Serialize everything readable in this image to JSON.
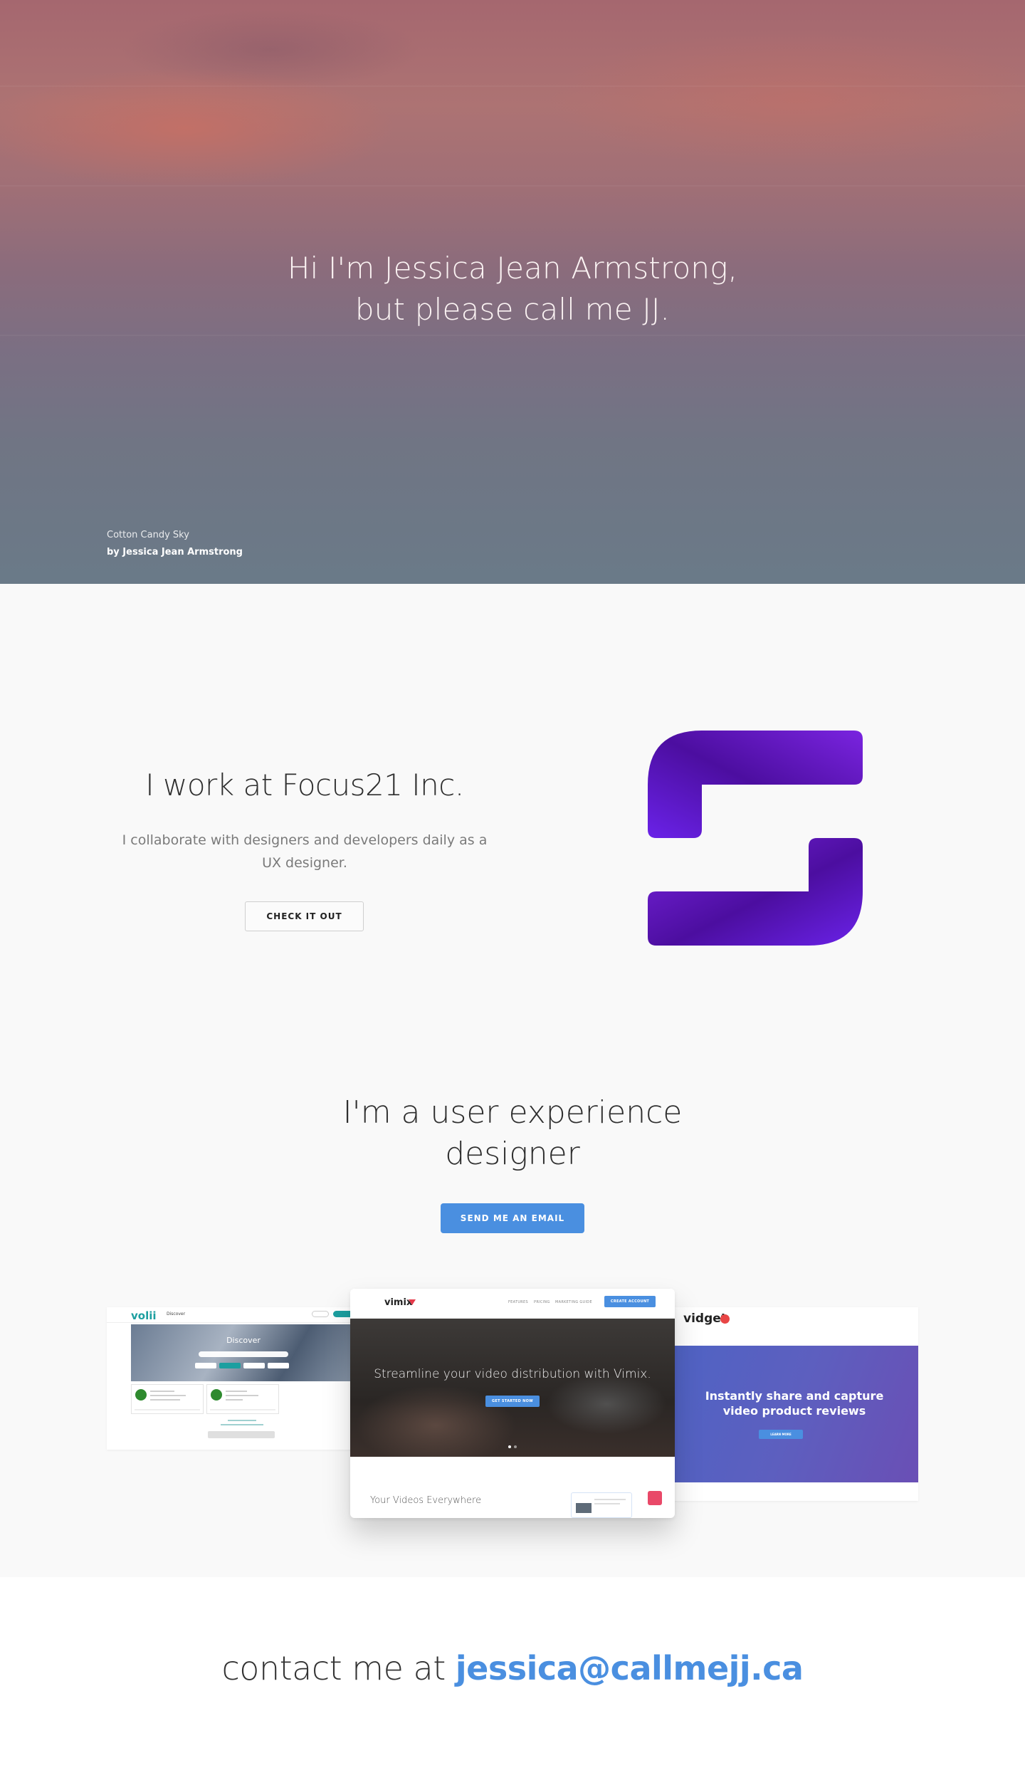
{
  "hero": {
    "title_line1": "Hi I'm Jessica Jean Armstrong,",
    "title_line2": "but please call me JJ.",
    "photo_title": "Cotton Candy Sky",
    "photo_author": "by Jessica Jean Armstrong"
  },
  "work": {
    "title": "I work at Focus21 Inc.",
    "description": "I collaborate with designers and developers daily as a UX designer.",
    "button_label": "CHECK IT OUT",
    "logo_icon": "focus21-logo"
  },
  "ux": {
    "title_line1": "I'm a user experience",
    "title_line2": "designer",
    "button_label": "SEND ME AN EMAIL"
  },
  "screenshots": {
    "volii": {
      "logo": "volii",
      "nav_link": "Discover",
      "banner_title": "Discover"
    },
    "vimix": {
      "logo": "vimix",
      "nav_links": [
        "FEATURES",
        "PRICING",
        "MARKETING GUIDE"
      ],
      "cta": "CREATE ACCOUNT",
      "hero_title": "Streamline your video distribution with Vimix.",
      "hero_button": "GET STARTED NOW",
      "subtitle": "Your Videos Everywhere"
    },
    "vidget": {
      "logo": "vidget",
      "panel_title_line1": "Instantly share and capture",
      "panel_title_line2": "video product reviews",
      "panel_button": "LEARN MORE"
    }
  },
  "contact": {
    "prefix": "contact me at",
    "email": "jessica@callmejj.ca"
  },
  "colors": {
    "accent": "#4a8fe0",
    "logo_purple_start": "#6a22e8",
    "logo_purple_end": "#4c0ea0"
  }
}
